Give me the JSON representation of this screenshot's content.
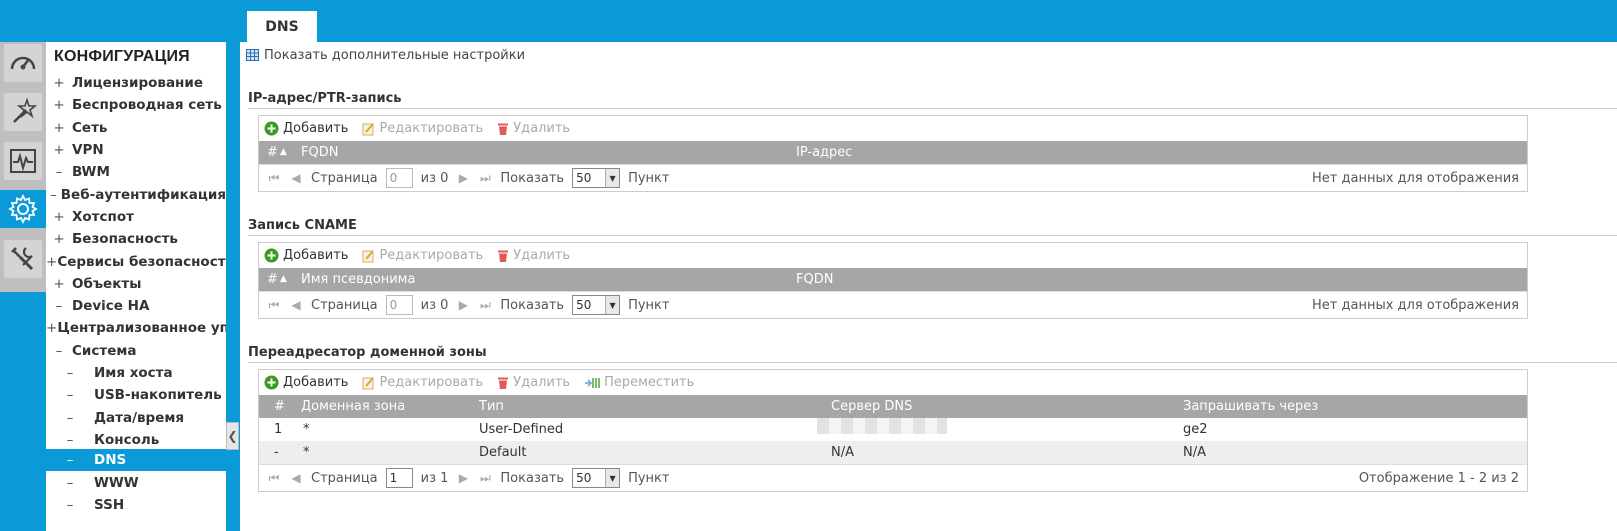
{
  "tab": {
    "label": "DNS"
  },
  "sidebar": {
    "title": "КОНФИГУРАЦИЯ",
    "items": [
      {
        "sign": "+",
        "label": "Лицензирование"
      },
      {
        "sign": "+",
        "label": "Беспроводная сеть"
      },
      {
        "sign": "+",
        "label": "Сеть"
      },
      {
        "sign": "+",
        "label": "VPN"
      },
      {
        "sign": "–",
        "label": "BWM"
      },
      {
        "sign": "–",
        "label": "Веб-аутентификация"
      },
      {
        "sign": "+",
        "label": "Хотспот"
      },
      {
        "sign": "+",
        "label": "Безопасность"
      },
      {
        "sign": "+",
        "label": "Сервисы безопасности"
      },
      {
        "sign": "+",
        "label": "Объекты"
      },
      {
        "sign": "–",
        "label": "Device HA"
      },
      {
        "sign": "+",
        "label": "Централизованное управление"
      },
      {
        "sign": "–",
        "label": "Система"
      },
      {
        "sign": "–",
        "label": "Имя хоста"
      },
      {
        "sign": "–",
        "label": "USB-накопитель"
      },
      {
        "sign": "–",
        "label": "Дата/время"
      },
      {
        "sign": "–",
        "label": "Консоль"
      },
      {
        "sign": "–",
        "label": "DNS"
      },
      {
        "sign": "–",
        "label": "WWW"
      },
      {
        "sign": "–",
        "label": "SSH"
      }
    ]
  },
  "icons": [
    "dashboard-icon",
    "wizard-icon",
    "monitor-icon",
    "configuration-gear-icon",
    "maintenance-tools-icon",
    "table-icon",
    "add-icon",
    "edit-icon",
    "delete-icon",
    "move-icon"
  ],
  "colors": {
    "accent": "#0a9ad8",
    "header_gray": "#a6a6a6",
    "add_green": "#3a9a1a",
    "delete_red": "#e05a5a"
  },
  "main": {
    "advanced_link": "Показать дополнительные настройки",
    "toolbar": {
      "add": "Добавить",
      "edit": "Редактировать",
      "delete": "Удалить",
      "move": "Переместить"
    },
    "pager": {
      "page": "Страница",
      "show": "Показать",
      "per_page": "50",
      "unit": "Пункт"
    },
    "sections": [
      {
        "title": "IP-адрес/PTR-запись",
        "columns": [
          "#",
          "FQDN",
          "IP-адрес"
        ],
        "page_value": "0",
        "of": "из 0",
        "status": "Нет данных для отображения"
      },
      {
        "title": "Запись CNAME",
        "columns": [
          "#",
          "Имя псевдонима",
          "FQDN"
        ],
        "page_value": "0",
        "of": "из 0",
        "status": "Нет данных для отображения"
      },
      {
        "title": "Переадресатор доменной зоны",
        "columns": [
          "#",
          "Доменная зона",
          "Тип",
          "Сервер DNS",
          "Запрашивать через"
        ],
        "rows": [
          {
            "num": "1",
            "zone": "*",
            "type": "User-Defined",
            "server": "",
            "via": "ge2"
          },
          {
            "num": "-",
            "zone": "*",
            "type": "Default",
            "server": "N/A",
            "via": "N/A"
          }
        ],
        "page_value": "1",
        "of": "из 1",
        "status": "Отображение 1 - 2 из 2"
      }
    ]
  }
}
